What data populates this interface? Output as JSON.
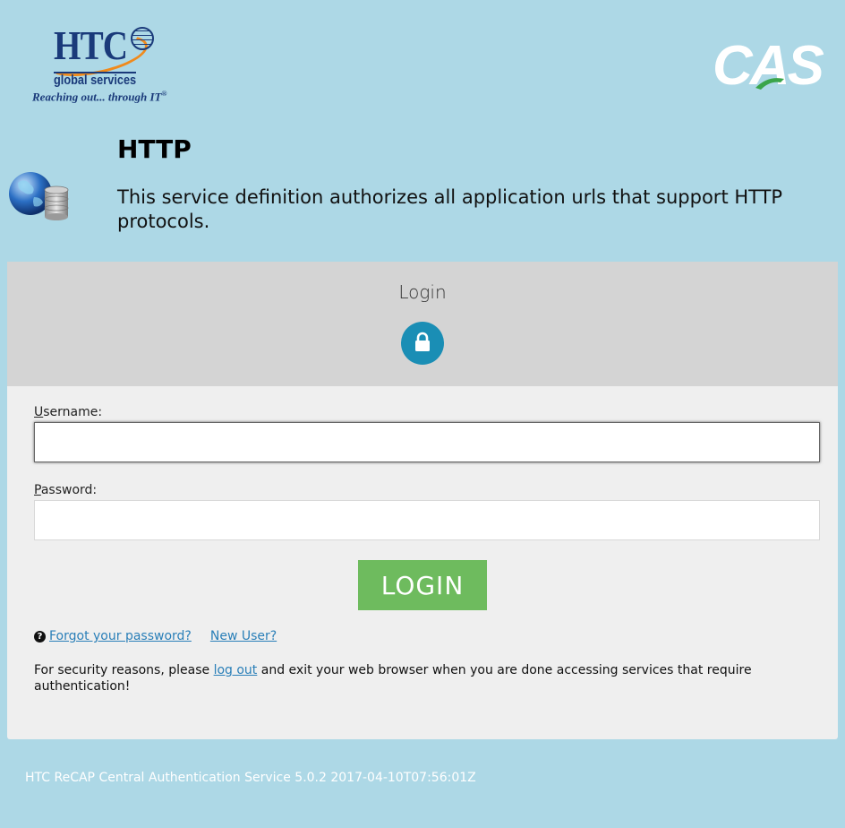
{
  "header": {
    "htc_logo": {
      "letters": "HTC",
      "subtitle": "global services",
      "tagline": "Reaching out... through IT",
      "registered": "®"
    },
    "cas_logo_text": "CAS"
  },
  "service": {
    "icon": "globe-database-icon",
    "title": "HTTP",
    "description": "This service definition authorizes all application urls that support HTTP protocols."
  },
  "login": {
    "title": "Login",
    "lock_icon": "lock-icon",
    "username": {
      "label_first": "U",
      "label_rest": "sername:",
      "value": ""
    },
    "password": {
      "label_first": "P",
      "label_rest": "assword:",
      "value": ""
    },
    "button_label": "LOGIN",
    "forgot_password": "Forgot your password?",
    "new_user": "New User?",
    "security_before": "For security reasons, please ",
    "security_link": "log out",
    "security_after": " and exit your web browser when you are done accessing services that require authentication!"
  },
  "footer": {
    "text": "HTC ReCAP Central Authentication Service 5.0.2 2017-04-10T07:56:01Z"
  },
  "colors": {
    "page_background": "#add8e6",
    "login_button": "#6ebb5e",
    "lock_circle": "#1a8eb5",
    "link": "#2a7fb8"
  }
}
